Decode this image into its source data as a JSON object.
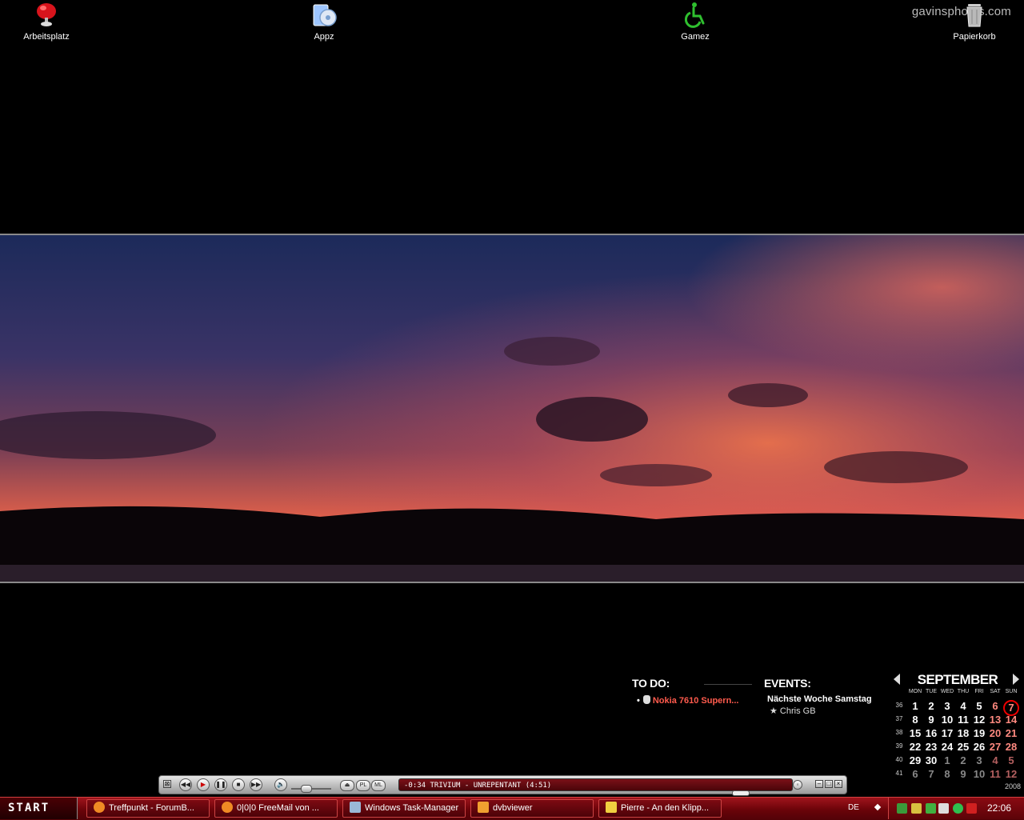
{
  "desktop": {
    "watermark": "gavinsphotos.com",
    "icons": [
      {
        "label": "Arbeitsplatz"
      },
      {
        "label": "Appz"
      },
      {
        "label": "Gamez"
      },
      {
        "label": "Papierkorb"
      }
    ]
  },
  "widgets": {
    "todo": {
      "title": "TO DO:",
      "items": [
        "Nokia 7610 Supern..."
      ]
    },
    "events": {
      "title": "EVENTS:",
      "line1": "Nächste Woche Samstag",
      "line2": "★ Chris GB"
    },
    "calendar": {
      "month": "SEPTEMBER",
      "year": "2008",
      "dow": [
        "MON",
        "TUE",
        "WED",
        "THU",
        "FRI",
        "SAT",
        "SUN"
      ],
      "weeks": [
        {
          "wk": "36",
          "days": [
            "",
            "1",
            "2",
            "3",
            "4",
            "5",
            "6",
            "7"
          ]
        },
        {
          "wk": "37",
          "days": [
            "8",
            "9",
            "10",
            "11",
            "12",
            "13",
            "14"
          ]
        },
        {
          "wk": "38",
          "days": [
            "15",
            "16",
            "17",
            "18",
            "19",
            "20",
            "21"
          ]
        },
        {
          "wk": "39",
          "days": [
            "22",
            "23",
            "24",
            "25",
            "26",
            "27",
            "28"
          ]
        },
        {
          "wk": "40",
          "days": [
            "29",
            "30",
            "1",
            "2",
            "3",
            "4",
            "5"
          ]
        },
        {
          "wk": "41",
          "days": [
            "6",
            "7",
            "8",
            "9",
            "10",
            "11",
            "12"
          ]
        }
      ]
    }
  },
  "player": {
    "track_text": "-0:34  TRIVIUM - UNREPENTANT (4:51)",
    "buttons": {
      "prev": "◀◀",
      "play": "▶",
      "pause": "❚❚",
      "stop": "■",
      "next": "▶▶"
    },
    "pills": {
      "eject": "⏏",
      "pl": "PL",
      "ml": "ML"
    }
  },
  "taskbar": {
    "start_label": "START",
    "tasks": [
      {
        "label": "Treffpunkt - ForumB...",
        "icon_color": "#f08a24"
      },
      {
        "label": "0|0|0  FreeMail von ...",
        "icon_color": "#f08a24"
      },
      {
        "label": "Windows Task-Manager",
        "icon_color": "#9ab8d8"
      },
      {
        "label": "dvbviewer",
        "icon_color": "#f0a030"
      },
      {
        "label": "Pierre - An den Klipp...",
        "icon_color": "#f0d040"
      }
    ],
    "language": "DE",
    "clock": "22:06"
  },
  "colors": {
    "taskbar": "#7a0a10",
    "accent_red": "#e00000",
    "todo_red": "#ff5b4d"
  }
}
